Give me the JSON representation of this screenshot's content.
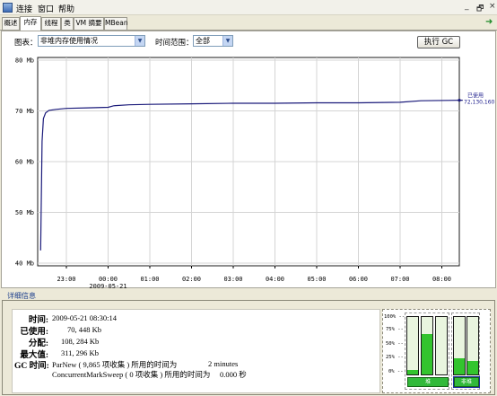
{
  "menubar": {
    "items": [
      "连接",
      "窗口",
      "帮助"
    ],
    "window_controls": [
      "_",
      "🗗",
      "×"
    ]
  },
  "tabs": [
    "概述",
    "内存",
    "线程",
    "类",
    "VM 摘要",
    "MBean"
  ],
  "active_tab": "内存",
  "toolbar": {
    "chart_label": "图表：",
    "chart_select_value": "非堆内存使用情况",
    "range_label": "时间范围：",
    "range_select_value": "全部",
    "gc_button": "执行 GC"
  },
  "chart_data": {
    "type": "line",
    "title": "",
    "xlabel": "",
    "ylabel": "",
    "y_unit": "Mb",
    "ylim": [
      40,
      80
    ],
    "y_ticks": [
      40,
      50,
      60,
      70,
      80
    ],
    "y_tick_labels": [
      "40 Mb",
      "50 Mb",
      "60 Mb",
      "70 Mb",
      "80 Mb"
    ],
    "x_tick_labels": [
      "23:00",
      "00:00",
      "01:00",
      "02:00",
      "03:00",
      "04:00",
      "05:00",
      "06:00",
      "07:00",
      "08:00"
    ],
    "x_date_label": "2009-05-21",
    "grid": true,
    "color": "#1a1a7a",
    "series": [
      {
        "name": "已使用",
        "x": [
          "22:23",
          "22:25",
          "22:27",
          "22:30",
          "22:35",
          "22:45",
          "23:00",
          "23:30",
          "00:00",
          "00:08",
          "00:30",
          "01:00",
          "02:00",
          "03:00",
          "04:00",
          "05:00",
          "06:00",
          "07:00",
          "07:30",
          "08:30"
        ],
        "values": [
          42.5,
          64.0,
          68.5,
          69.6,
          70.1,
          70.3,
          70.5,
          70.6,
          70.7,
          71.0,
          71.2,
          71.3,
          71.4,
          71.5,
          71.5,
          71.6,
          71.6,
          71.7,
          72.0,
          72.1
        ]
      }
    ],
    "annotation": {
      "label": "已使用",
      "value": "72,130,160"
    }
  },
  "details": {
    "title": "详细信息",
    "rows": [
      {
        "key": "时间:",
        "value": "2009-05-21 08:30:14"
      },
      {
        "key": "已使用:",
        "value": "70, 448 Kb"
      },
      {
        "key": "分配:",
        "value": "108, 284 Kb"
      },
      {
        "key": "最大值:",
        "value": "311, 296 Kb"
      },
      {
        "key": "GC 时间:",
        "value": "ParNew ( 9,865 项收集 ) 所用的时间为",
        "extra": "2 minutes"
      }
    ],
    "gc2": {
      "value": "ConcurrentMarkSweep ( 0 项收集 ) 所用的时间为",
      "extra": "0.000 秒"
    }
  },
  "gauges": {
    "labels": [
      "100% --",
      "75% --",
      "50% --",
      "25% --",
      "0% --"
    ],
    "heap_fills": [
      0.08,
      0.7,
      0.0
    ],
    "nonheap_fills": [
      0.28,
      0.23
    ],
    "heap_button": "堆",
    "nonheap_button": "非堆"
  }
}
